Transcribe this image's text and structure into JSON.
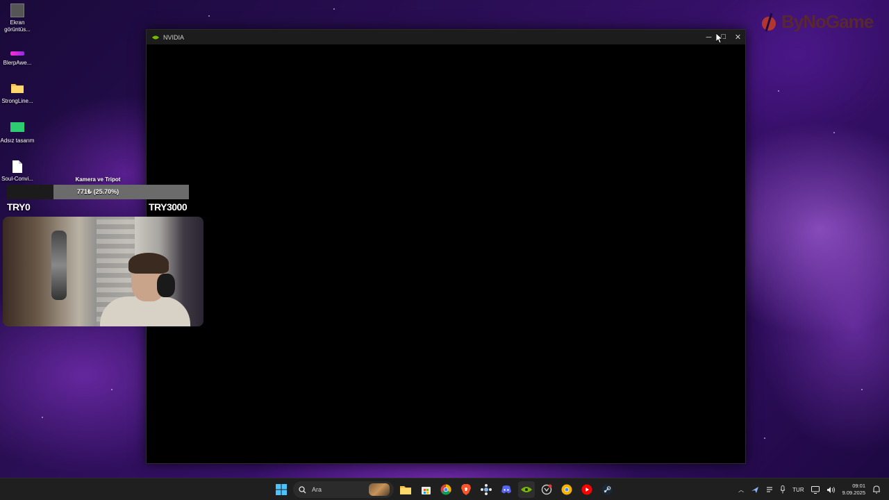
{
  "desktop": {
    "icons": [
      {
        "label_lines": [
          "Ekran",
          "görüntüs..."
        ],
        "icon": "screenshot-image-icon",
        "color": "#555555"
      },
      {
        "label_lines": [
          "BlerpAwe..."
        ],
        "icon": "blerp-app-icon",
        "color": "#8e2de2"
      },
      {
        "label_lines": [
          "StrongLine..."
        ],
        "icon": "folder-icon",
        "color": "#f2c14e"
      },
      {
        "label_lines": [
          "Adsız tasarım"
        ],
        "icon": "design-image-icon",
        "color": "#2ecc71"
      },
      {
        "label_lines": [
          "Soul-Convi..."
        ],
        "icon": "document-icon",
        "color": "#ffffff"
      }
    ]
  },
  "watermark": {
    "text": "ByNoGame",
    "color": "#5b2a2a"
  },
  "window": {
    "title": "NVIDIA",
    "controls": {
      "minimize": "─",
      "maximize": "☐",
      "close": "✕"
    },
    "accent": "#76b900"
  },
  "overlay": {
    "goal_title": "Kamera ve Tripot",
    "goal_progress_text": "771₺ (25.70%)",
    "goal_progress_fraction": 0.257,
    "goal_min": "TRY0",
    "goal_max": "TRY3000"
  },
  "taskbar": {
    "search_placeholder": "Ara",
    "pinned": [
      {
        "name": "file-explorer-icon",
        "color": "#f2c14e"
      },
      {
        "name": "microsoft-store-icon",
        "color": "#e8e8e8"
      },
      {
        "name": "chrome-icon",
        "color": "#4285f4"
      },
      {
        "name": "brave-icon",
        "color": "#fb542b"
      },
      {
        "name": "network-app-icon",
        "color": "#7fb2e5"
      },
      {
        "name": "discord-icon",
        "color": "#5865f2"
      },
      {
        "name": "nvidia-icon",
        "color": "#76b900",
        "active": true
      },
      {
        "name": "overwolf-icon",
        "color": "#cfcfcf"
      },
      {
        "name": "chrome-canary-icon",
        "color": "#f4b400"
      },
      {
        "name": "youtube-music-icon",
        "color": "#ff0000"
      },
      {
        "name": "steam-icon",
        "color": "#c7d5e0"
      }
    ],
    "tray": {
      "language": "TUR",
      "time": "09:01",
      "date": "9.09.2025"
    }
  }
}
